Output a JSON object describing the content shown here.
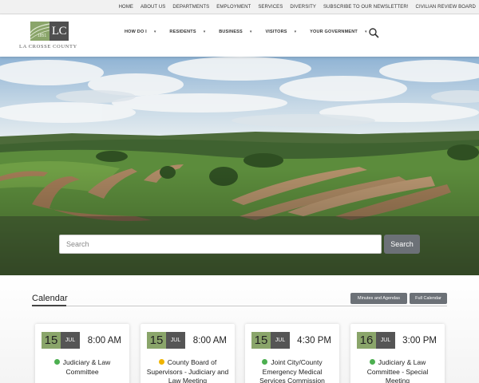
{
  "utility_nav": [
    "HOME",
    "ABOUT US",
    "DEPARTMENTS",
    "EMPLOYMENT",
    "SERVICES",
    "DIVERSITY",
    "SUBSCRIBE TO OUR NEWSLETTER!",
    "CIVILIAN REVIEW BOARD"
  ],
  "logo": {
    "letters": "LC",
    "year": "1851",
    "name": "LA CROSSE COUNTY"
  },
  "main_nav": [
    {
      "label": "HOW DO I",
      "caret": "▾"
    },
    {
      "label": "RESIDENTS",
      "caret": "▾"
    },
    {
      "label": "BUSINESS",
      "caret": "▾"
    },
    {
      "label": "VISITORS",
      "caret": "▾"
    },
    {
      "label": "YOUR GOVERNMENT",
      "caret": "▾"
    }
  ],
  "search": {
    "placeholder": "Search",
    "button": "Search"
  },
  "calendar": {
    "title": "Calendar",
    "minutes_button": "Minutes and Agendas",
    "full_button": "Full Calendar",
    "events": [
      {
        "day": "15",
        "month": "JUL",
        "time": "8:00 AM",
        "title": "Judiciary & Law Committee",
        "dot_color": "#4caf50"
      },
      {
        "day": "15",
        "month": "JUL",
        "time": "8:00 AM",
        "title": "County Board of Supervisors - Judiciary and Law Meeting",
        "dot_color": "#f0b400"
      },
      {
        "day": "15",
        "month": "JUL",
        "time": "4:30 PM",
        "title": "Joint City/County Emergency Medical Services Commission",
        "dot_color": "#4caf50"
      },
      {
        "day": "16",
        "month": "JUL",
        "time": "3:00 PM",
        "title": "Judiciary & Law Committee - Special Meeting",
        "dot_color": "#4caf50"
      }
    ]
  }
}
